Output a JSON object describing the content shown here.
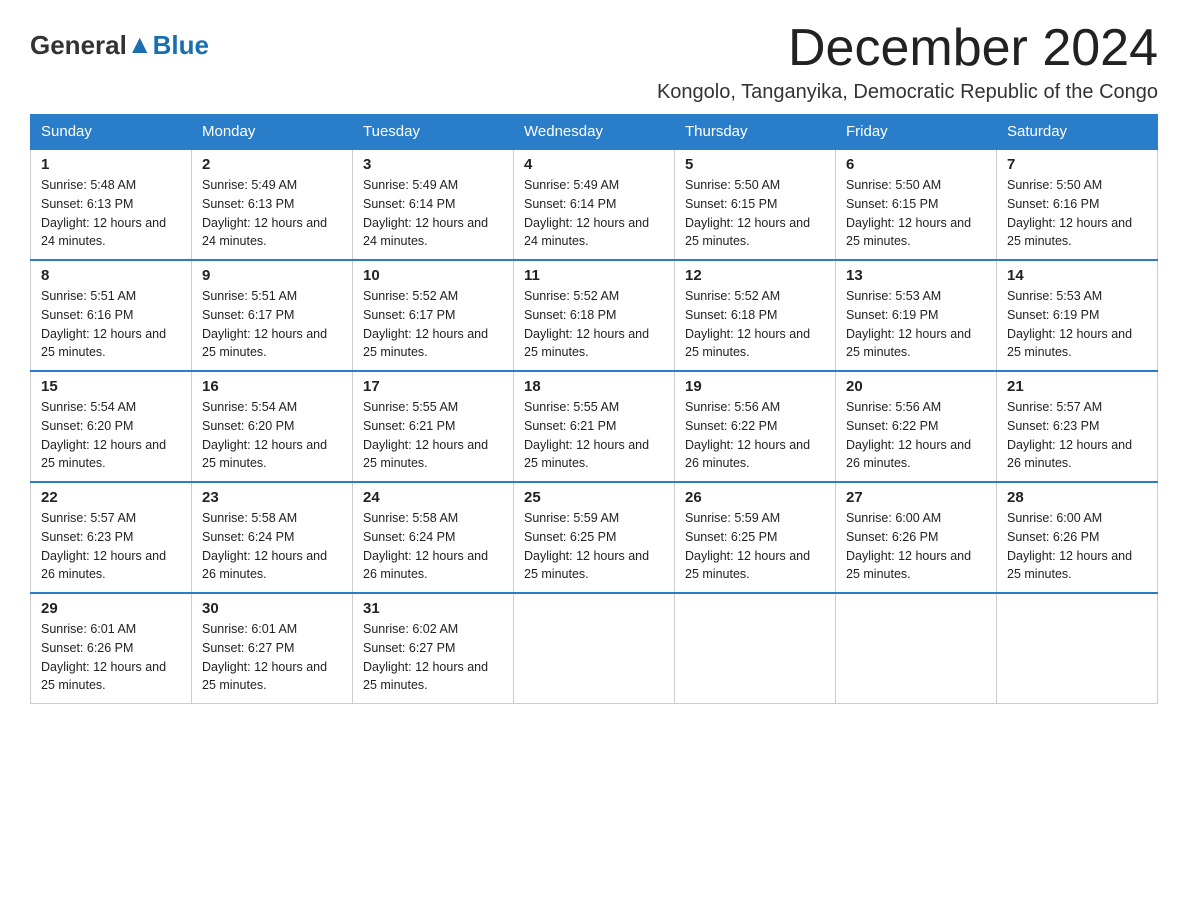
{
  "header": {
    "logo_general": "General",
    "logo_blue": "Blue",
    "month_title": "December 2024",
    "location": "Kongolo, Tanganyika, Democratic Republic of the Congo"
  },
  "days_of_week": [
    "Sunday",
    "Monday",
    "Tuesday",
    "Wednesday",
    "Thursday",
    "Friday",
    "Saturday"
  ],
  "weeks": [
    [
      {
        "day": "1",
        "sunrise": "5:48 AM",
        "sunset": "6:13 PM",
        "daylight": "12 hours and 24 minutes."
      },
      {
        "day": "2",
        "sunrise": "5:49 AM",
        "sunset": "6:13 PM",
        "daylight": "12 hours and 24 minutes."
      },
      {
        "day": "3",
        "sunrise": "5:49 AM",
        "sunset": "6:14 PM",
        "daylight": "12 hours and 24 minutes."
      },
      {
        "day": "4",
        "sunrise": "5:49 AM",
        "sunset": "6:14 PM",
        "daylight": "12 hours and 24 minutes."
      },
      {
        "day": "5",
        "sunrise": "5:50 AM",
        "sunset": "6:15 PM",
        "daylight": "12 hours and 25 minutes."
      },
      {
        "day": "6",
        "sunrise": "5:50 AM",
        "sunset": "6:15 PM",
        "daylight": "12 hours and 25 minutes."
      },
      {
        "day": "7",
        "sunrise": "5:50 AM",
        "sunset": "6:16 PM",
        "daylight": "12 hours and 25 minutes."
      }
    ],
    [
      {
        "day": "8",
        "sunrise": "5:51 AM",
        "sunset": "6:16 PM",
        "daylight": "12 hours and 25 minutes."
      },
      {
        "day": "9",
        "sunrise": "5:51 AM",
        "sunset": "6:17 PM",
        "daylight": "12 hours and 25 minutes."
      },
      {
        "day": "10",
        "sunrise": "5:52 AM",
        "sunset": "6:17 PM",
        "daylight": "12 hours and 25 minutes."
      },
      {
        "day": "11",
        "sunrise": "5:52 AM",
        "sunset": "6:18 PM",
        "daylight": "12 hours and 25 minutes."
      },
      {
        "day": "12",
        "sunrise": "5:52 AM",
        "sunset": "6:18 PM",
        "daylight": "12 hours and 25 minutes."
      },
      {
        "day": "13",
        "sunrise": "5:53 AM",
        "sunset": "6:19 PM",
        "daylight": "12 hours and 25 minutes."
      },
      {
        "day": "14",
        "sunrise": "5:53 AM",
        "sunset": "6:19 PM",
        "daylight": "12 hours and 25 minutes."
      }
    ],
    [
      {
        "day": "15",
        "sunrise": "5:54 AM",
        "sunset": "6:20 PM",
        "daylight": "12 hours and 25 minutes."
      },
      {
        "day": "16",
        "sunrise": "5:54 AM",
        "sunset": "6:20 PM",
        "daylight": "12 hours and 25 minutes."
      },
      {
        "day": "17",
        "sunrise": "5:55 AM",
        "sunset": "6:21 PM",
        "daylight": "12 hours and 25 minutes."
      },
      {
        "day": "18",
        "sunrise": "5:55 AM",
        "sunset": "6:21 PM",
        "daylight": "12 hours and 25 minutes."
      },
      {
        "day": "19",
        "sunrise": "5:56 AM",
        "sunset": "6:22 PM",
        "daylight": "12 hours and 26 minutes."
      },
      {
        "day": "20",
        "sunrise": "5:56 AM",
        "sunset": "6:22 PM",
        "daylight": "12 hours and 26 minutes."
      },
      {
        "day": "21",
        "sunrise": "5:57 AM",
        "sunset": "6:23 PM",
        "daylight": "12 hours and 26 minutes."
      }
    ],
    [
      {
        "day": "22",
        "sunrise": "5:57 AM",
        "sunset": "6:23 PM",
        "daylight": "12 hours and 26 minutes."
      },
      {
        "day": "23",
        "sunrise": "5:58 AM",
        "sunset": "6:24 PM",
        "daylight": "12 hours and 26 minutes."
      },
      {
        "day": "24",
        "sunrise": "5:58 AM",
        "sunset": "6:24 PM",
        "daylight": "12 hours and 26 minutes."
      },
      {
        "day": "25",
        "sunrise": "5:59 AM",
        "sunset": "6:25 PM",
        "daylight": "12 hours and 25 minutes."
      },
      {
        "day": "26",
        "sunrise": "5:59 AM",
        "sunset": "6:25 PM",
        "daylight": "12 hours and 25 minutes."
      },
      {
        "day": "27",
        "sunrise": "6:00 AM",
        "sunset": "6:26 PM",
        "daylight": "12 hours and 25 minutes."
      },
      {
        "day": "28",
        "sunrise": "6:00 AM",
        "sunset": "6:26 PM",
        "daylight": "12 hours and 25 minutes."
      }
    ],
    [
      {
        "day": "29",
        "sunrise": "6:01 AM",
        "sunset": "6:26 PM",
        "daylight": "12 hours and 25 minutes."
      },
      {
        "day": "30",
        "sunrise": "6:01 AM",
        "sunset": "6:27 PM",
        "daylight": "12 hours and 25 minutes."
      },
      {
        "day": "31",
        "sunrise": "6:02 AM",
        "sunset": "6:27 PM",
        "daylight": "12 hours and 25 minutes."
      },
      null,
      null,
      null,
      null
    ]
  ]
}
